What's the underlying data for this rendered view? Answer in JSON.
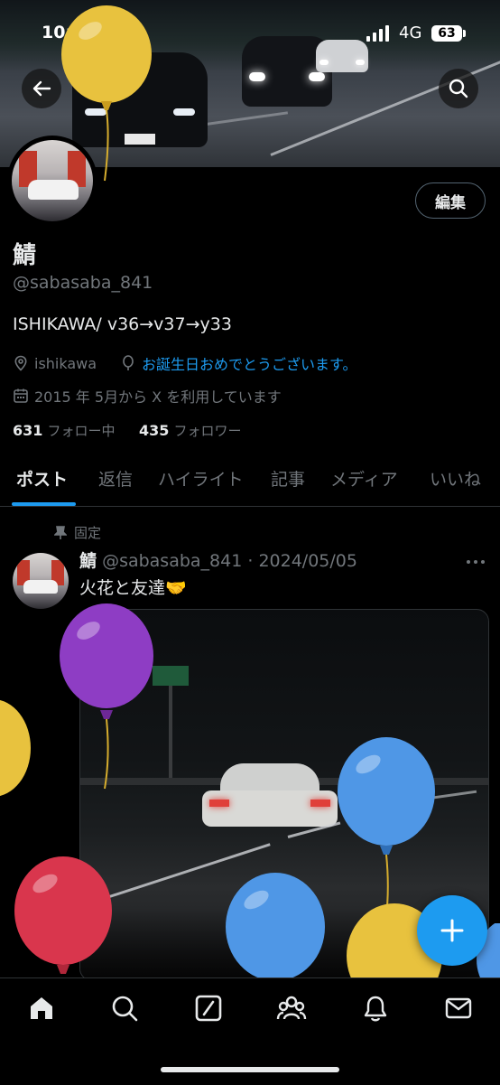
{
  "status_bar": {
    "time": "10:19",
    "network": "4G",
    "battery": "63"
  },
  "header": {
    "back_icon": "arrow-left-icon",
    "search_icon": "search-icon"
  },
  "profile": {
    "name": "鯖",
    "handle": "@sabasaba_841",
    "edit_label": "編集",
    "bio": "ISHIKAWA/ v36→v37→y33",
    "location": "ishikawa",
    "website": "お誕生日おめでとうございます。",
    "joined": "2015 年 5月から X を利用しています",
    "following_count": "631",
    "following_label": "フォロー中",
    "followers_count": "435",
    "followers_label": "フォロワー"
  },
  "tabs": [
    {
      "label": "ポスト",
      "active": true
    },
    {
      "label": "返信"
    },
    {
      "label": "ハイライト"
    },
    {
      "label": "記事"
    },
    {
      "label": "メディア"
    },
    {
      "label": "いいね"
    }
  ],
  "post": {
    "pinned_label": "固定",
    "author": "鯖",
    "handle_date": "@sabasaba_841 · 2024/05/05",
    "text": "火花と友達🤝",
    "more_icon": "more-icon"
  },
  "colors": {
    "accent": "#1d9bf0",
    "muted": "#71767b",
    "text": "#e7e9ea",
    "border": "#2f3336"
  },
  "bottom_nav": [
    "home-icon",
    "search-icon",
    "grok-icon",
    "communities-icon",
    "notifications-icon",
    "messages-icon"
  ]
}
